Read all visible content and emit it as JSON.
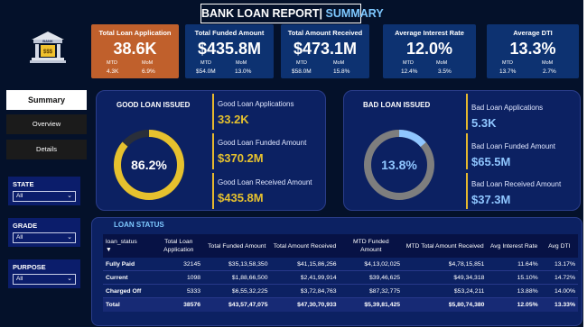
{
  "title": {
    "main": "BANK LOAN REPORT|",
    "accent": "SUMMARY"
  },
  "logo": {
    "text": "BANK"
  },
  "kpis": [
    {
      "title": "Total Loan Application",
      "value": "38.6K",
      "mtd_label": "MTD",
      "mom_label": "MoM",
      "mtd": "4.3K",
      "mom": "6.9%",
      "bg": "#c0602c"
    },
    {
      "title": "Total Funded Amount",
      "value": "$435.8M",
      "mtd_label": "MTD",
      "mom_label": "MoM",
      "mtd": "$54.0M",
      "mom": "13.0%",
      "bg": "#0d3271"
    },
    {
      "title": "Total Amount Received",
      "value": "$473.1M",
      "mtd_label": "MTD",
      "mom_label": "MoM",
      "mtd": "$58.0M",
      "mom": "15.8%",
      "bg": "#0d3271"
    },
    {
      "title": "Average Interest Rate",
      "value": "12.0%",
      "mtd_label": "MTD",
      "mom_label": "MoM",
      "mtd": "12.4%",
      "mom": "3.5%",
      "bg": "#0d3271"
    },
    {
      "title": "Average DTI",
      "value": "13.3%",
      "mtd_label": "MTD",
      "mom_label": "MoM",
      "mtd": "13.7%",
      "mom": "2.7%",
      "bg": "#0d3271"
    }
  ],
  "nav": {
    "summary": "Summary",
    "overview": "Overview",
    "details": "Details"
  },
  "filters": [
    {
      "label": "STATE",
      "value": "All"
    },
    {
      "label": "GRADE",
      "value": "All"
    },
    {
      "label": "PURPOSE",
      "value": "All"
    }
  ],
  "good_loan": {
    "title": "GOOD LOAN ISSUED",
    "percent_text": "86.2%",
    "percent_value": 86.2,
    "apps_label": "Good Loan Applications",
    "apps_value": "33.2K",
    "funded_label": "Good Loan Funded Amount",
    "funded_value": "$370.2M",
    "received_label": "Good Loan Received Amount",
    "received_value": "$435.8M",
    "accent": "#e6c12e"
  },
  "bad_loan": {
    "title": "BAD LOAN ISSUED",
    "percent_text": "13.8%",
    "percent_value": 13.8,
    "apps_label": "Bad Loan Applications",
    "apps_value": "5.3K",
    "funded_label": "Bad Loan Funded Amount",
    "funded_value": "$65.5M",
    "received_label": "Bad Loan Received Amount",
    "received_value": "$37.3M",
    "accent": "#8fc6ff"
  },
  "loan_status": {
    "title": "LOAN STATUS",
    "headers": [
      "loan_status",
      "Total Loan Application",
      "Total Funded Amount",
      "Total Amount Received",
      "MTD Funded Amount",
      "MTD Total Amount Received",
      "Avg Interest Rate",
      "Avg DTI"
    ],
    "rows": [
      [
        "Fully Paid",
        "32145",
        "$35,13,58,350",
        "$41,15,86,256",
        "$4,13,02,025",
        "$4,78,15,851",
        "11.64%",
        "13.17%"
      ],
      [
        "Current",
        "1098",
        "$1,88,66,500",
        "$2,41,99,914",
        "$39,46,625",
        "$49,34,318",
        "15.10%",
        "14.72%"
      ],
      [
        "Charged Off",
        "5333",
        "$6,55,32,225",
        "$3,72,84,763",
        "$87,32,775",
        "$53,24,211",
        "13.88%",
        "14.00%"
      ]
    ],
    "total": [
      "Total",
      "38576",
      "$43,57,47,075",
      "$47,30,70,933",
      "$5,39,81,425",
      "$5,80,74,380",
      "12.05%",
      "13.33%"
    ]
  }
}
